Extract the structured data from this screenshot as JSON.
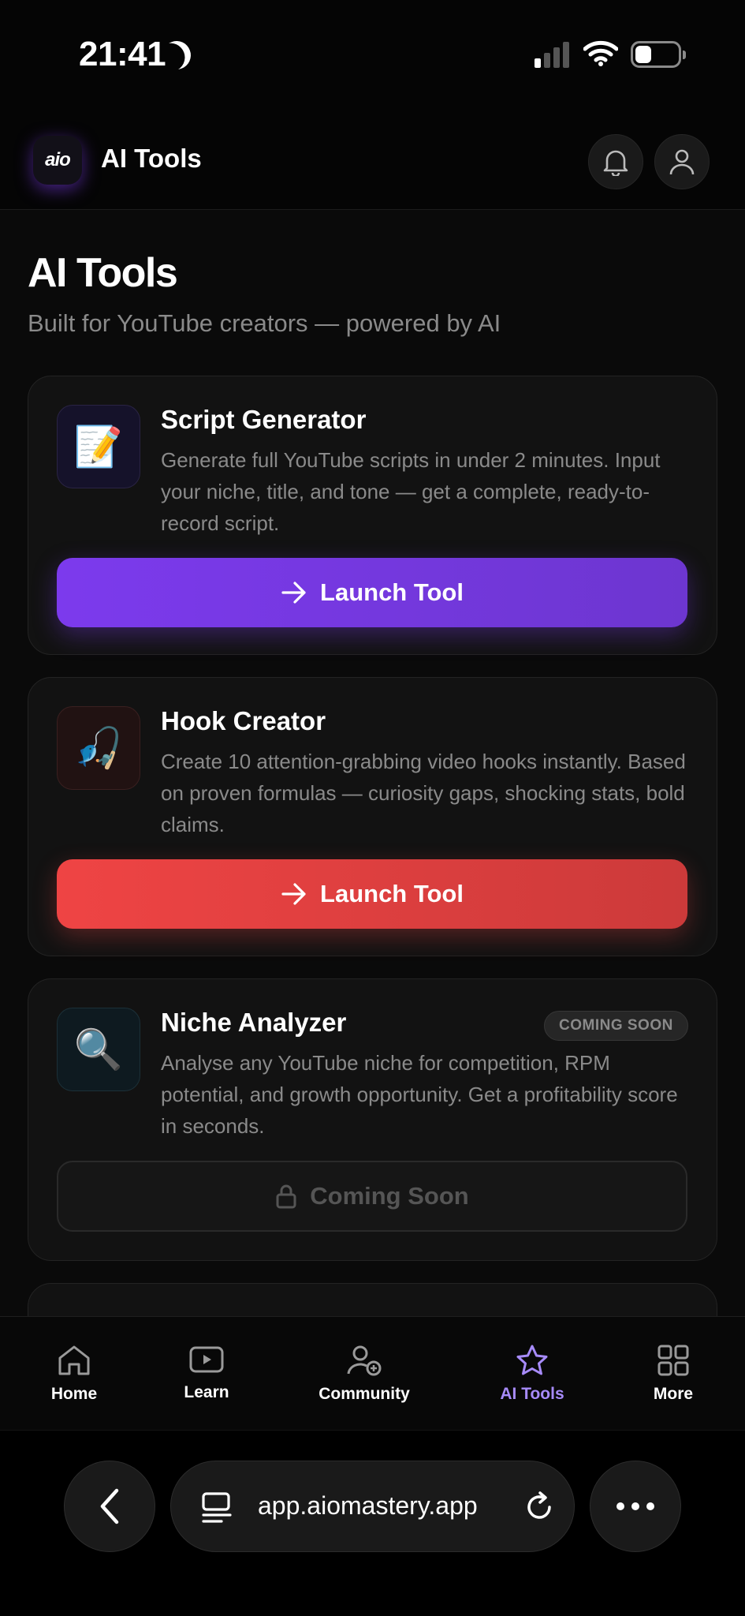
{
  "status_bar": {
    "time": "21:41"
  },
  "header": {
    "logo_text": "aio",
    "title": "AI Tools"
  },
  "page": {
    "title": "AI Tools",
    "subtitle": "Built for YouTube creators — powered by AI"
  },
  "tools": [
    {
      "icon": "memo-icon",
      "emoji": "📝",
      "title": "Script Generator",
      "description": "Generate full YouTube scripts in under 2 minutes. Input your niche, title, and tone — get a complete, ready-to-record script.",
      "button": "Launch Tool",
      "accent": "#7c3aed"
    },
    {
      "icon": "fishing-icon",
      "emoji": "🎣",
      "title": "Hook Creator",
      "description": "Create 10 attention-grabbing video hooks instantly. Based on proven formulas — curiosity gaps, shocking stats, bold claims.",
      "button": "Launch Tool",
      "accent": "#ef4444"
    },
    {
      "icon": "magnifier-icon",
      "emoji": "🔍",
      "title": "Niche Analyzer",
      "description": "Analyse any YouTube niche for competition, RPM potential, and growth opportunity. Get a profitability score in seconds.",
      "badge": "COMING SOON",
      "button": "Coming Soon",
      "accent": "#0ea5e9"
    }
  ],
  "nav": [
    {
      "label": "Home",
      "icon": "home-icon"
    },
    {
      "label": "Learn",
      "icon": "play-icon"
    },
    {
      "label": "Community",
      "icon": "user-plus-icon"
    },
    {
      "label": "AI Tools",
      "icon": "star-icon",
      "active": true
    },
    {
      "label": "More",
      "icon": "grid-icon"
    }
  ],
  "browser": {
    "url": "app.aiomastery.app"
  },
  "colors": {
    "accent_purple": "#7c3aed",
    "accent_red": "#ef4444",
    "active_nav": "#a78bfa",
    "background": "#0a0a0a"
  }
}
